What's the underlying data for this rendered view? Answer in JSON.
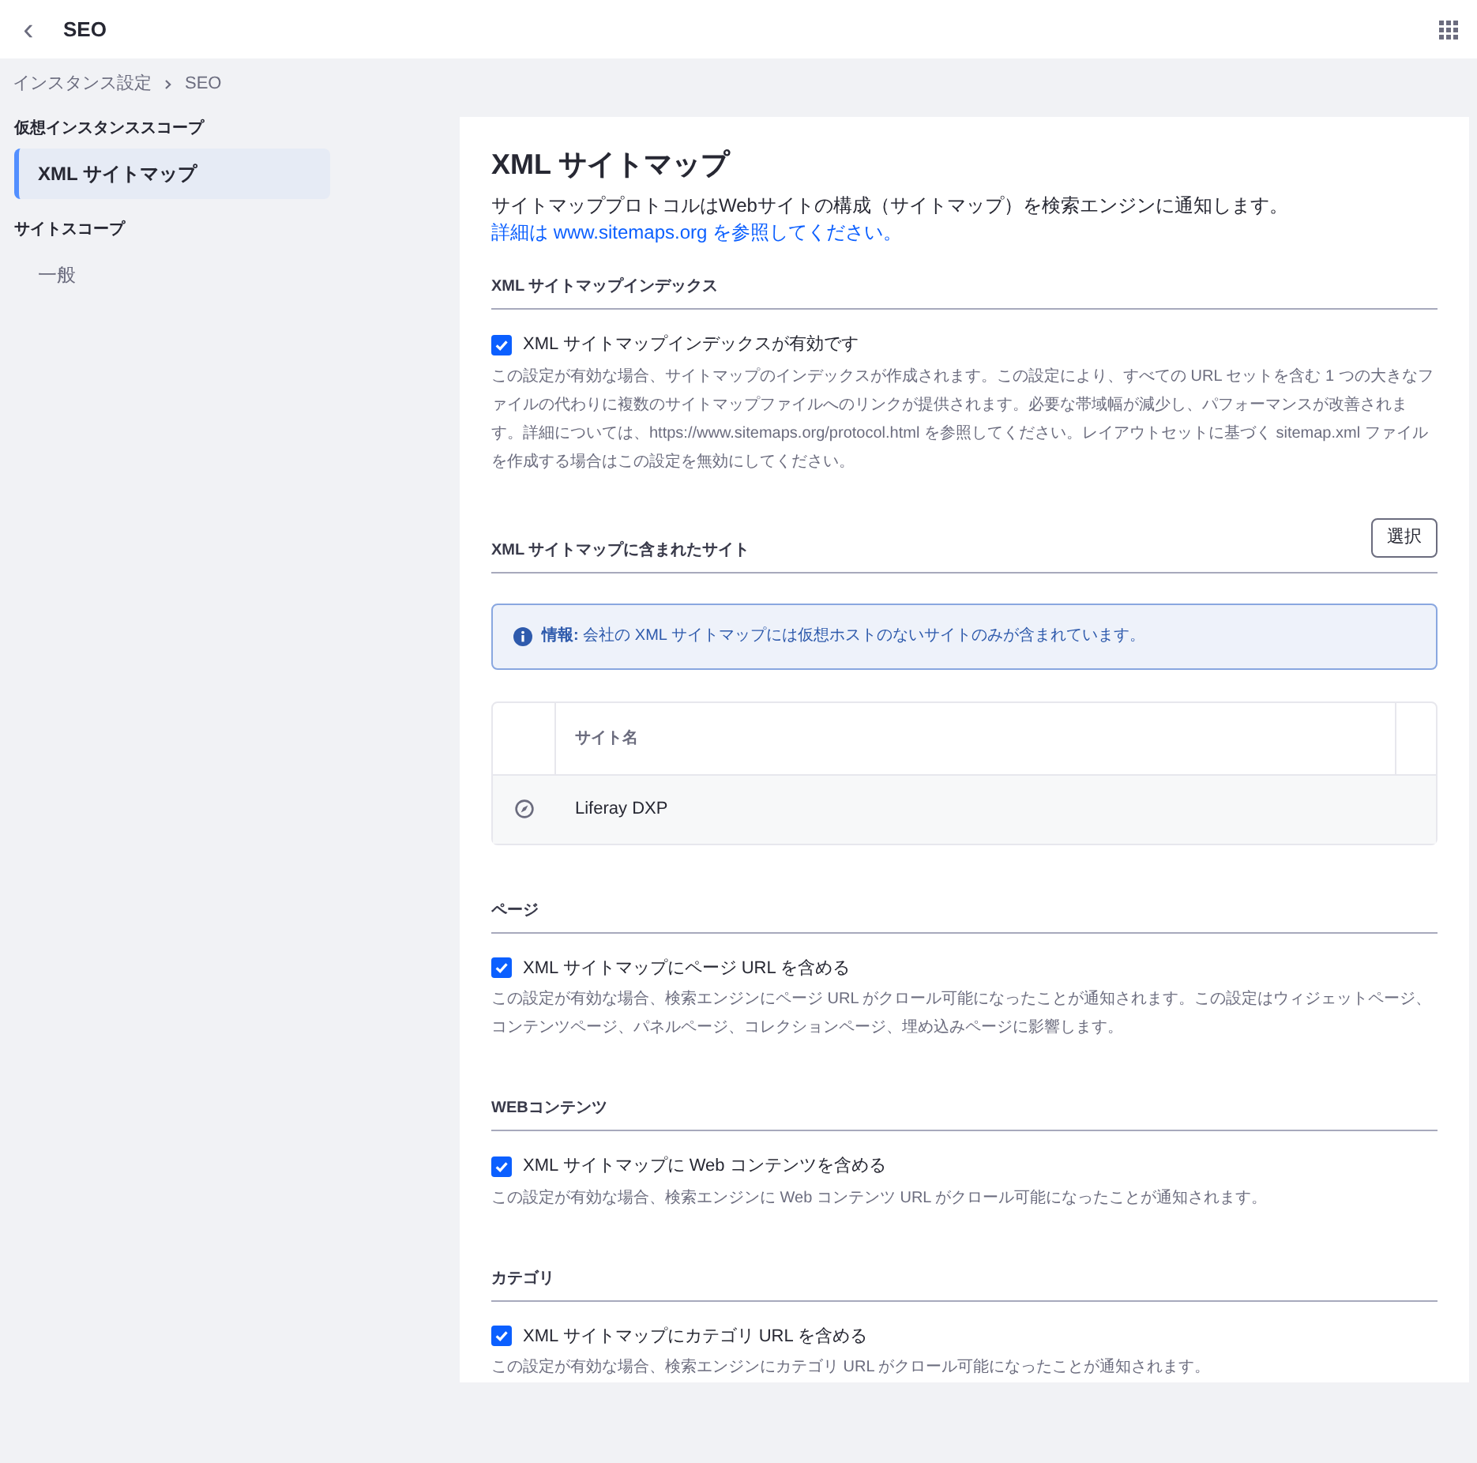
{
  "header": {
    "back": "‹",
    "title": "SEO"
  },
  "breadcrumb": [
    {
      "label": "インスタンス設定"
    },
    {
      "label": "SEO"
    }
  ],
  "sidebar": [
    {
      "heading": "仮想インスタンススコープ",
      "items": [
        {
          "label": "XML サイトマップ",
          "selected": true
        }
      ]
    },
    {
      "heading": "サイトスコープ",
      "items": [
        {
          "label": "一般",
          "selected": false
        }
      ]
    }
  ],
  "content": {
    "title": "XML サイトマップ",
    "description": "サイトマッププロトコルはWebサイトの構成（サイトマップ）を検索エンジンに通知します。",
    "link": "詳細は www.sitemaps.org を参照してください。",
    "sections": [
      {
        "kind": "checkbox",
        "heading": "XML サイトマップインデックス",
        "label": "XML サイトマップインデックスが有効です",
        "checked": true,
        "help": "この設定が有効な場合、サイトマップのインデックスが作成されます。この設定により、すべての URL セットを含む 1 つの大きなファイルの代わりに複数のサイトマップファイルへのリンクが提供されます。必要な帯域幅が減少し、パフォーマンスが改善されます。詳細については、https://www.sitemaps.org/protocol.html を参照してください。レイアウトセットに基づく sitemap.xml ファイルを作成する場合はこの設定を無効にしてください。"
      },
      {
        "kind": "sites",
        "heading": "XML サイトマップに含まれたサイト",
        "button": "選択",
        "info": "**情報:** 会社の XML サイトマップには仮想ホストのないサイトのみが含まれています。",
        "column": "サイト名",
        "rows": [
          {
            "name": "Liferay DXP"
          }
        ]
      },
      {
        "kind": "checkbox",
        "heading": "ページ",
        "label": "XML サイトマップにページ URL を含める",
        "checked": true,
        "help": "この設定が有効な場合、検索エンジンにページ URL がクロール可能になったことが通知されます。この設定はウィジェットページ、コンテンツページ、パネルページ、コレクションページ、埋め込みページに影響します。"
      },
      {
        "kind": "checkbox",
        "heading": "WEBコンテンツ",
        "label": "XML サイトマップに Web コンテンツを含める",
        "checked": true,
        "help": "この設定が有効な場合、検索エンジンに Web コンテンツ URL がクロール可能になったことが通知されます。"
      },
      {
        "kind": "checkbox",
        "heading": "カテゴリ",
        "label": "XML サイトマップにカテゴリ URL を含める",
        "checked": true,
        "help": "この設定が有効な場合、検索エンジンにカテゴリ URL がクロール可能になったことが通知されます。"
      }
    ]
  }
}
